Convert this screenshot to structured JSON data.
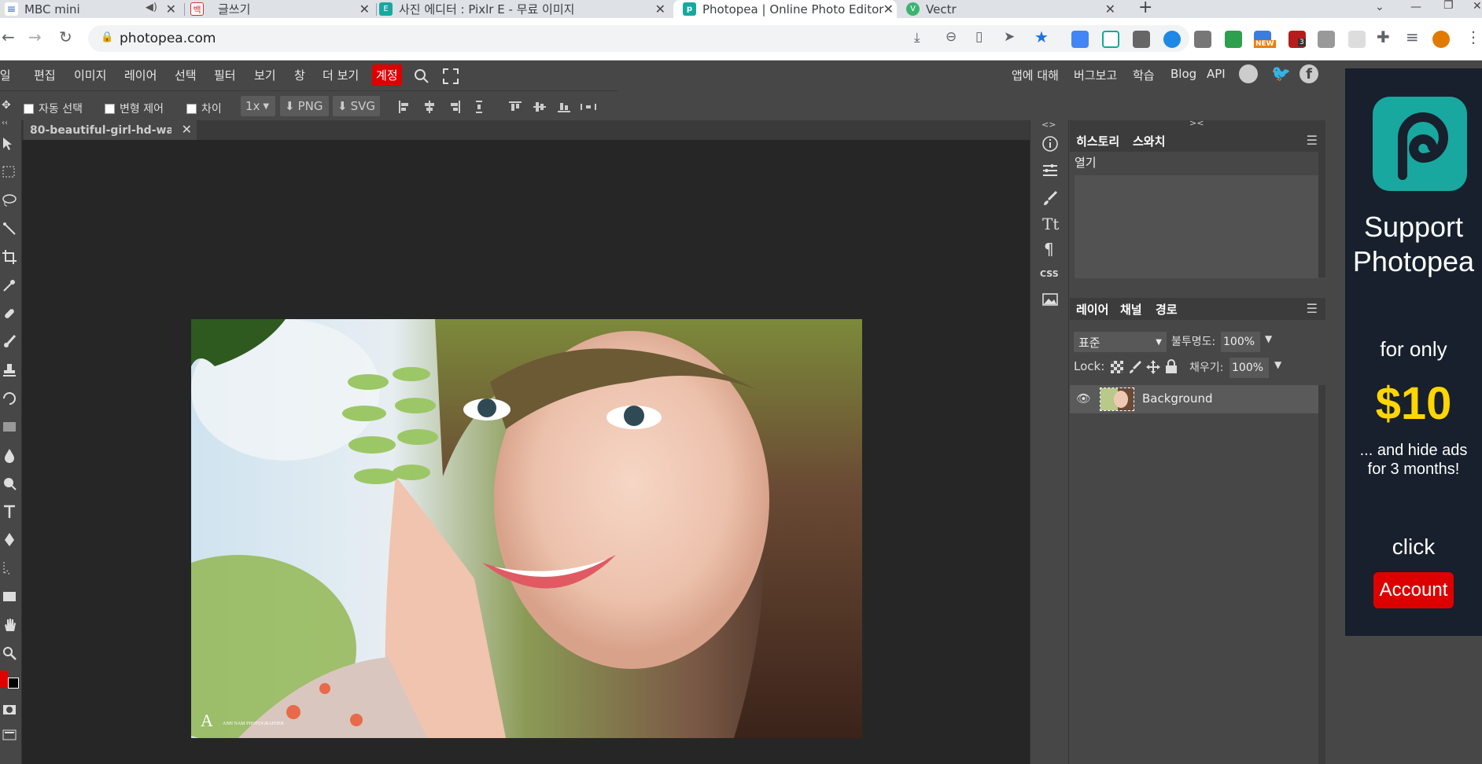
{
  "browser": {
    "tabs": [
      {
        "title": "MBC mini",
        "favicon_color": "#3b6fd8",
        "audio": true
      },
      {
        "title": "글쓰기",
        "favicon_color": "#d93025"
      },
      {
        "title": "사진 에디터 : Pixlr E - 무료 이미지",
        "favicon_color": "#18a8a0"
      },
      {
        "title": "Photopea | Online Photo Editor",
        "favicon_color": "#18a8a0",
        "active": true
      },
      {
        "title": "Vectr",
        "favicon_color": "#3cb371"
      }
    ],
    "new_tab": "+",
    "url": "photopea.com",
    "badges": {
      "new": "NEW",
      "count": "3"
    }
  },
  "menubar": {
    "items": [
      "파일",
      "편집",
      "이미지",
      "레이어",
      "선택",
      "필터",
      "보기",
      "창",
      "더 보기"
    ],
    "account": "계정",
    "right": [
      "앱에 대해",
      "버그보고",
      "학습",
      "Blog",
      "API"
    ]
  },
  "options": {
    "auto_select": "자동 선택",
    "transform": "변형 제어",
    "diff": "차이",
    "scale": "1x",
    "png": "PNG",
    "svg": "SVG"
  },
  "document": {
    "tab_title": "80-beautiful-girl-hd-wa",
    "watermark": "ANH NAM PHOTOGRAPHER"
  },
  "panels": {
    "collapse_left": "<>",
    "collapse_right": "><",
    "history_tabs": [
      "히스토리",
      "스와치"
    ],
    "history_items": [
      "열기"
    ],
    "layer_tabs": [
      "레이어",
      "채널",
      "경로"
    ],
    "blend_mode": "표준",
    "opacity_label": "불투명도:",
    "opacity_value": "100%",
    "lock_label": "Lock:",
    "fill_label": "채우기:",
    "fill_value": "100%",
    "layer_name": "Background",
    "icon_css": "CSS"
  },
  "ad": {
    "line1": "Support",
    "line2": "Photopea",
    "line3": "for only",
    "price": "$10",
    "line4": "... and hide ads",
    "line5": "for 3 months!",
    "line6": "click",
    "button": "Account"
  },
  "colors": {
    "accent_red": "#d00000",
    "photopea_teal": "#18a8a0",
    "ad_bg": "#17202c",
    "ad_price": "#ffd600"
  }
}
